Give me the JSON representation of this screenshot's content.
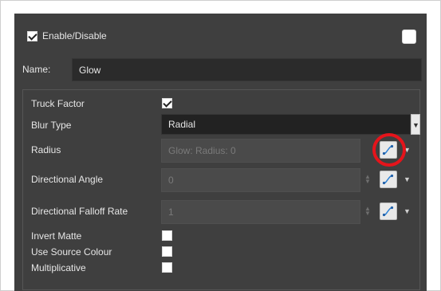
{
  "header": {
    "enable_label": "Enable/Disable",
    "enable_checked": true,
    "right_checkbox_checked": false
  },
  "name": {
    "label": "Name:",
    "value": "Glow"
  },
  "params": {
    "truck_factor": {
      "label": "Truck Factor",
      "checked": true
    },
    "blur_type": {
      "label": "Blur Type",
      "value": "Radial"
    },
    "radius": {
      "label": "Radius",
      "placeholder": "Glow: Radius: 0"
    },
    "directional_angle": {
      "label": "Directional Angle",
      "value": "0"
    },
    "directional_falloff_rate": {
      "label": "Directional Falloff Rate",
      "value": "1"
    },
    "invert_matte": {
      "label": "Invert Matte",
      "checked": false
    },
    "use_source_colour": {
      "label": "Use Source Colour",
      "checked": false
    },
    "multiplicative": {
      "label": "Multiplicative",
      "checked": false
    }
  },
  "icons": {
    "curve_button": "function-curve-icon",
    "dropdown": "chevron-down-icon",
    "spinner": "spinner-arrows-icon"
  },
  "colors": {
    "highlight": "#e5141b",
    "panel": "#3f3f3f"
  }
}
